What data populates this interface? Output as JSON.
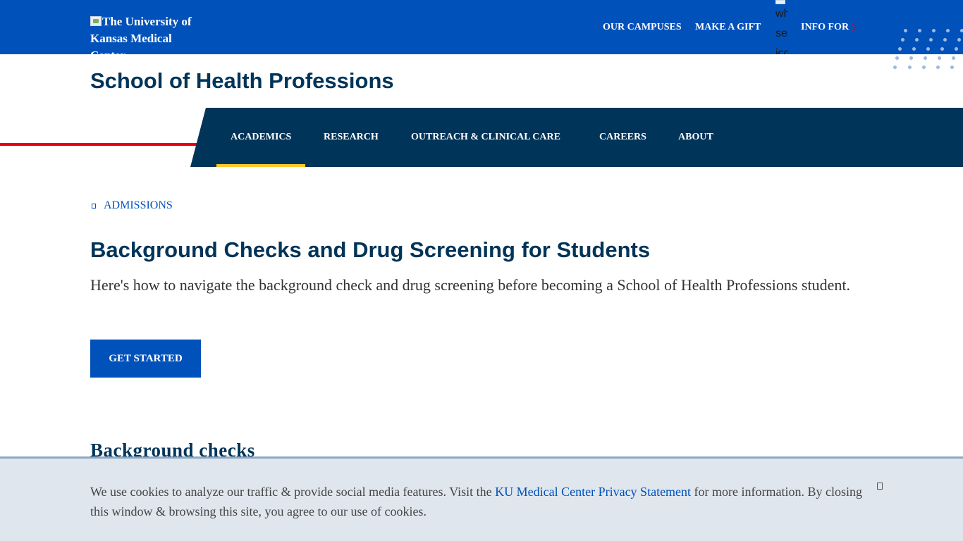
{
  "header": {
    "logo_alt": "The University of Kansas Medical Center",
    "links": {
      "campuses": "OUR CAMPUSES",
      "gift": "MAKE A GIFT",
      "info_for": "INFO FOR"
    },
    "search_icon_alt": "white search icon",
    "info_for_icon": "chevron-down-icon"
  },
  "site": {
    "title": "School of Health Professions"
  },
  "nav": {
    "items": [
      {
        "label": "ACADEMICS",
        "active": true
      },
      {
        "label": "RESEARCH"
      },
      {
        "label": "OUTREACH & CLINICAL CARE"
      },
      {
        "label": "CAREERS"
      },
      {
        "label": "ABOUT"
      }
    ]
  },
  "breadcrumb": {
    "label": "ADMISSIONS",
    "icon": "chevron-left-icon"
  },
  "main": {
    "title": "Background Checks and Drug Screening for Students",
    "intro": "Here's how to navigate the background check and drug screening before becoming a School of Health Professions student.",
    "cta_label": "GET STARTED",
    "section_heading": "Background checks"
  },
  "cookie": {
    "text_before": "We use cookies to analyze our traffic & provide social media features. Visit the ",
    "link_text": "KU Medical Center Privacy Statement",
    "text_after": " for more information. By closing this window & browsing this site, you agree to our use of cookies.",
    "close_icon": "close-icon"
  },
  "colors": {
    "ku_blue": "#0051ba",
    "navy": "#003459",
    "red": "#e8000d",
    "gold": "#ffc82d",
    "cookie_bg": "#dfe6ee"
  }
}
